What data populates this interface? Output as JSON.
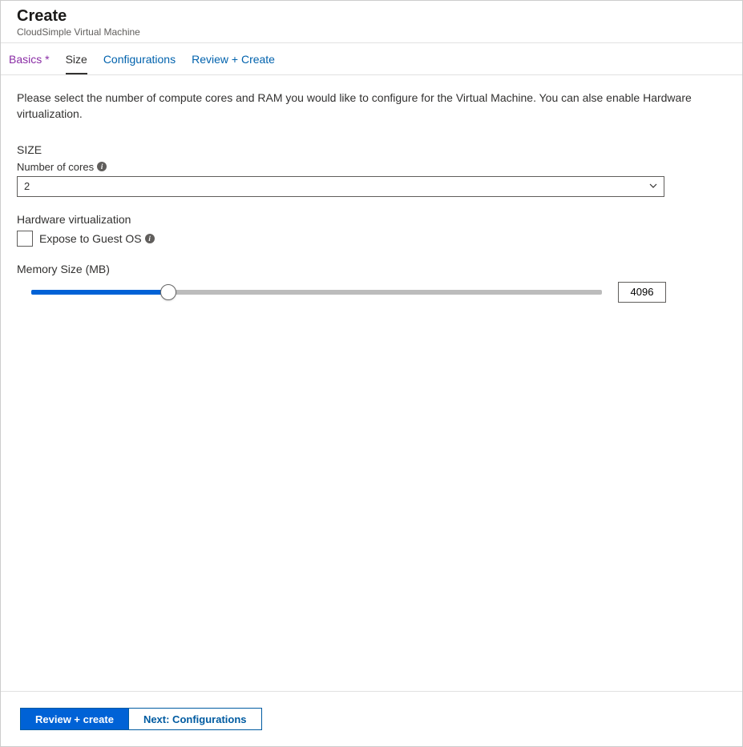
{
  "header": {
    "title": "Create",
    "subtitle": "CloudSimple Virtual Machine"
  },
  "tabs": {
    "basics": "Basics *",
    "size": "Size",
    "configurations": "Configurations",
    "review": "Review + Create"
  },
  "content": {
    "description": "Please select the number of compute cores and RAM you would like to configure for the Virtual Machine. You can alse enable Hardware virtualization.",
    "section_title": "SIZE",
    "cores": {
      "label": "Number of cores",
      "value": "2"
    },
    "hardware": {
      "label": "Hardware virtualization",
      "checkbox_label": "Expose to Guest OS"
    },
    "memory": {
      "label": "Memory Size (MB)",
      "value": "4096"
    }
  },
  "footer": {
    "review_button": "Review + create",
    "next_button": "Next: Configurations"
  }
}
